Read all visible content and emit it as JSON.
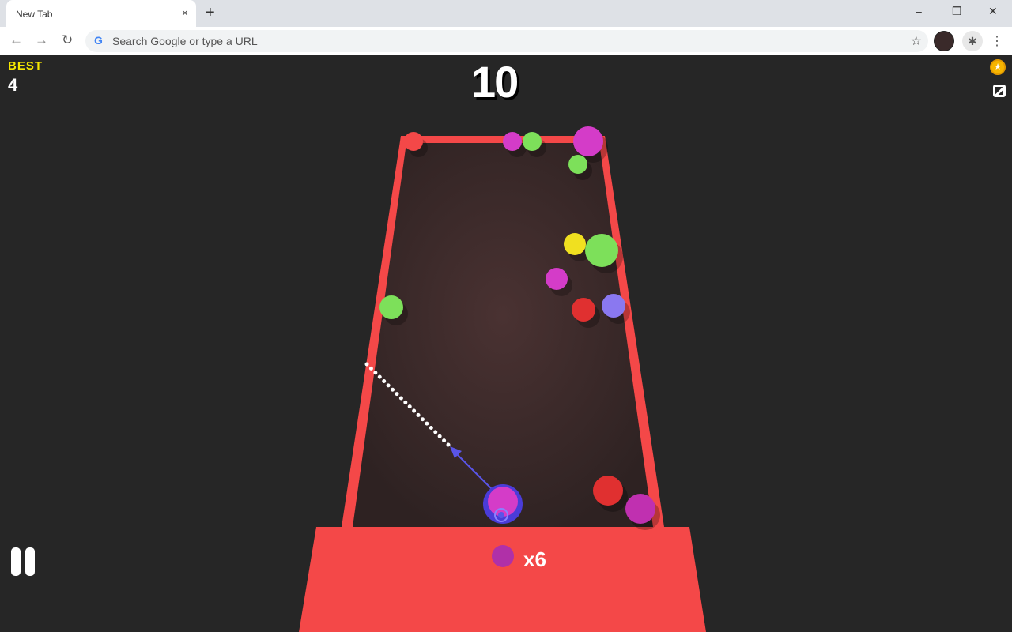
{
  "browser": {
    "tab_title": "New Tab",
    "close_tab": "×",
    "new_tab": "+",
    "omnibox_placeholder": "Search Google or type a URL",
    "minimize": "–",
    "restore": "❐",
    "close": "✕",
    "back": "←",
    "forward": "→",
    "reload": "↻",
    "bookmark": "☆",
    "extensions": "✱",
    "menu": "⋮"
  },
  "game": {
    "best_label": "BEST",
    "best_value": "4",
    "score": "10",
    "shots_remaining": "x6",
    "coin_icon": "★",
    "colors": {
      "table_rim": "#f44848",
      "table_felt": "#3a2a2a",
      "platform": "#f44848",
      "aim": "#5a55e8",
      "yellow": "#f5e600"
    },
    "balls": [
      {
        "color": "#f44848"
      },
      {
        "color": "#d43cc8"
      },
      {
        "color": "#7de05a"
      },
      {
        "color": "#d43cc8"
      },
      {
        "color": "#7de05a"
      },
      {
        "color": "#f0e020"
      },
      {
        "color": "#7de05a"
      },
      {
        "color": "#d43cc8"
      },
      {
        "color": "#7de05a"
      },
      {
        "color": "#e03030"
      },
      {
        "color": "#8a78f0"
      },
      {
        "color": "#e03030"
      },
      {
        "color": "#c030b0"
      }
    ],
    "shooter_ball_color": "#d43cc8"
  }
}
